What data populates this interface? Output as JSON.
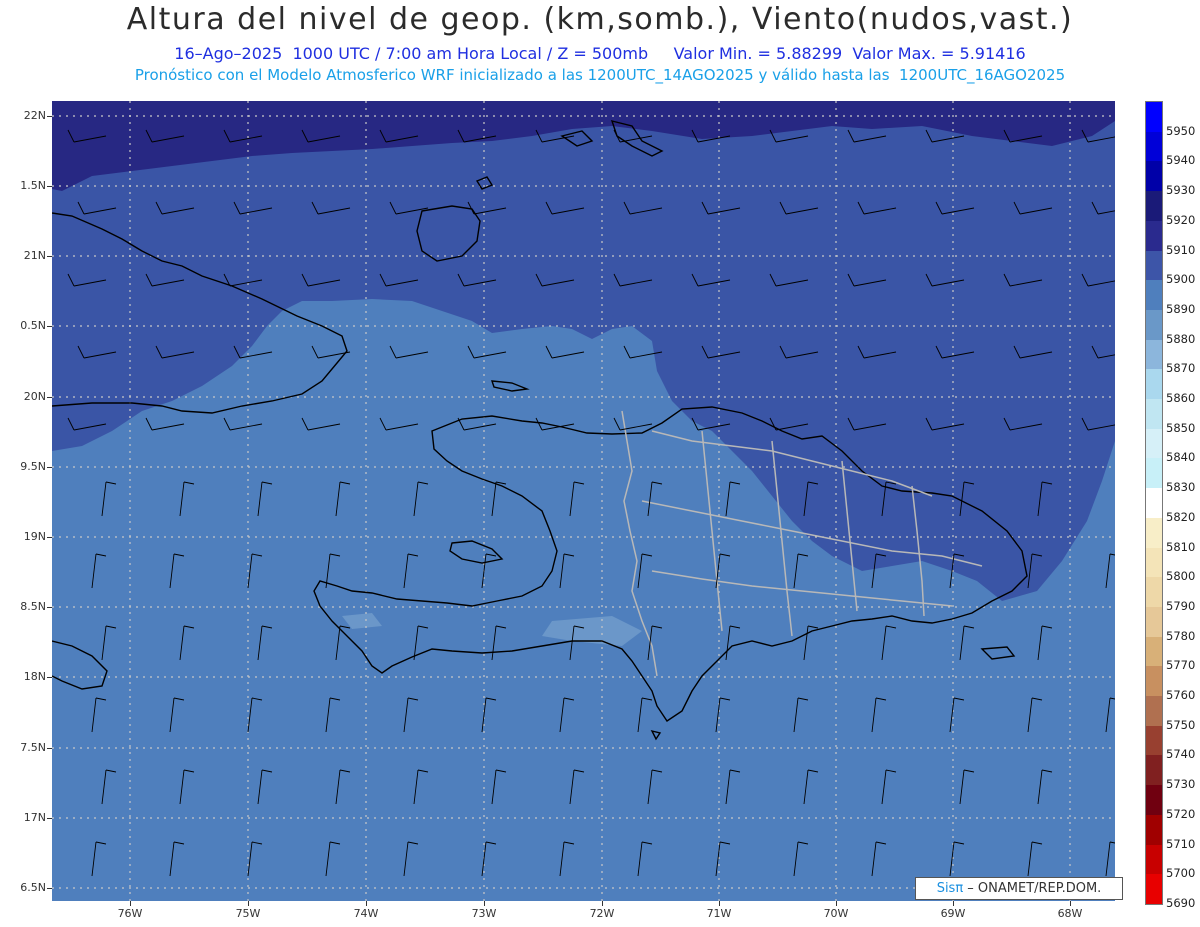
{
  "header": {
    "title": "Altura del nivel de geop. (km,somb.), Viento(nudos,vast.)",
    "line1": "16–Ago–2025  1000 UTC / 7:00 am Hora Local / Z = 500mb     Valor Min. = 5.88299  Valor Max. = 5.91416",
    "line2": "Pronóstico con el Modelo Atmosferico WRF inicializado a las 1200UTC_14AGO2025 y válido hasta las  1200UTC_16AGO2025"
  },
  "axes": {
    "lat_labels": [
      "22N",
      "1.5N",
      "21N",
      "0.5N",
      "20N",
      "9.5N",
      "19N",
      "8.5N",
      "18N",
      "7.5N",
      "17N",
      "6.5N"
    ],
    "lon_labels": [
      "76W",
      "75W",
      "74W",
      "73W",
      "72W",
      "71W",
      "70W",
      "69W",
      "68W"
    ]
  },
  "colorbar": {
    "levels": [
      "5950",
      "5940",
      "5930",
      "5920",
      "5910",
      "5900",
      "5890",
      "5880",
      "5870",
      "5860",
      "5850",
      "5840",
      "5830",
      "5820",
      "5810",
      "5800",
      "5790",
      "5780",
      "5770",
      "5760",
      "5750",
      "5740",
      "5730",
      "5720",
      "5710",
      "5700",
      "5690"
    ],
    "colors": [
      "#0000ff",
      "#0000d8",
      "#0000a8",
      "#1a1a78",
      "#2a2a8e",
      "#3d55a8",
      "#4f7fbd",
      "#6a98c8",
      "#8cb6dc",
      "#aad8ee",
      "#c0e6f2",
      "#d6f0f8",
      "#c8f0f8",
      "#ffffff",
      "#f8eec8",
      "#f4e4b8",
      "#eed8a8",
      "#e6c898",
      "#d8b078",
      "#c89060",
      "#b07050",
      "#984030",
      "#802020",
      "#700010",
      "#a00000",
      "#c80000",
      "#e80000"
    ]
  },
  "map_colors": {
    "dark": "#272883",
    "mid": "#3a55a6",
    "base": "#4f7fbd",
    "light": "#6b97c9"
  },
  "credit": {
    "brand": "Sisπ",
    "text": " – ONAMET/REP.DOM."
  }
}
